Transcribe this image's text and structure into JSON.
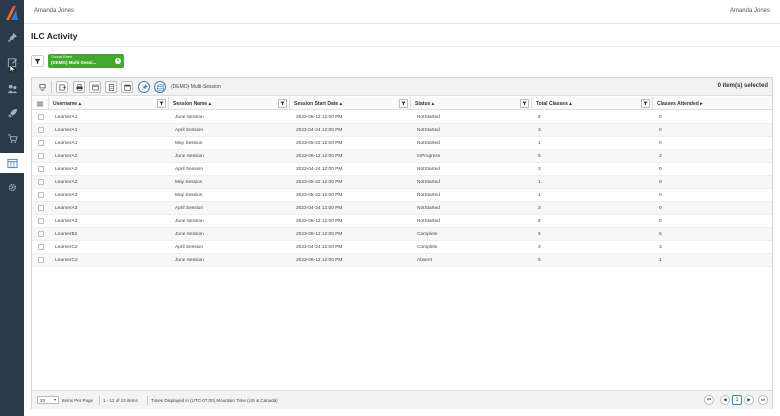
{
  "header": {
    "user_left": "Amanda Jones",
    "user_right": "Amanda Jones"
  },
  "page": {
    "title": "ILC Activity"
  },
  "filter_chip": {
    "line1": "Course Event",
    "line2": "(DEMO) Multi-Sessi..."
  },
  "toolbar": {
    "label": "(DEMO) Multi-Session",
    "selected": "0 item(s) selected"
  },
  "columns": [
    "Username",
    "Session Name",
    "Session Start Date",
    "Status",
    "Total Classes",
    "Classes Attended"
  ],
  "rows": [
    [
      "LearnerA1",
      "June Session",
      "2023-06-12 12:00 PM",
      "NotStarted",
      "5",
      "0"
    ],
    [
      "LearnerA1",
      "April Session",
      "2023-04-24 12:00 PM",
      "NotStarted",
      "3",
      "0"
    ],
    [
      "LearnerA1",
      "May Session",
      "2023-05-22 12:00 PM",
      "NotStarted",
      "1",
      "0"
    ],
    [
      "LearnerA2",
      "June Session",
      "2023-06-12 12:00 PM",
      "InProgress",
      "5",
      "3"
    ],
    [
      "LearnerA2",
      "April Session",
      "2023-04-24 12:00 PM",
      "NotStarted",
      "3",
      "0"
    ],
    [
      "LearnerA2",
      "May Session",
      "2023-05-22 12:00 PM",
      "NotStarted",
      "1",
      "0"
    ],
    [
      "LearnerA3",
      "May Session",
      "2023-05-22 12:00 PM",
      "NotStarted",
      "1",
      "0"
    ],
    [
      "LearnerA3",
      "April Session",
      "2023-04-24 12:00 PM",
      "NotStarted",
      "3",
      "0"
    ],
    [
      "LearnerA3",
      "June Session",
      "2023-06-12 12:00 PM",
      "NotStarted",
      "5",
      "0"
    ],
    [
      "LearnerB2",
      "June Session",
      "2023-06-12 12:00 PM",
      "Complete",
      "5",
      "5"
    ],
    [
      "LearnerC2",
      "April Session",
      "2023-04-24 12:00 PM",
      "Complete",
      "3",
      "3"
    ],
    [
      "LearnerC2",
      "June Session",
      "2023-06-12 12:00 PM",
      "Absent",
      "5",
      "1"
    ]
  ],
  "footer": {
    "page_size": "20",
    "items_per_page": "Items Per Page",
    "range": "1 - 12 of 12 items",
    "timezone": "Times Displayed in (UTC-07:00) Mountain Time (US & Canada)",
    "current_page": "1"
  },
  "colors": {
    "sidebar": "#2b3a48",
    "chip": "#45a82e",
    "accent": "#3b7fc4"
  }
}
